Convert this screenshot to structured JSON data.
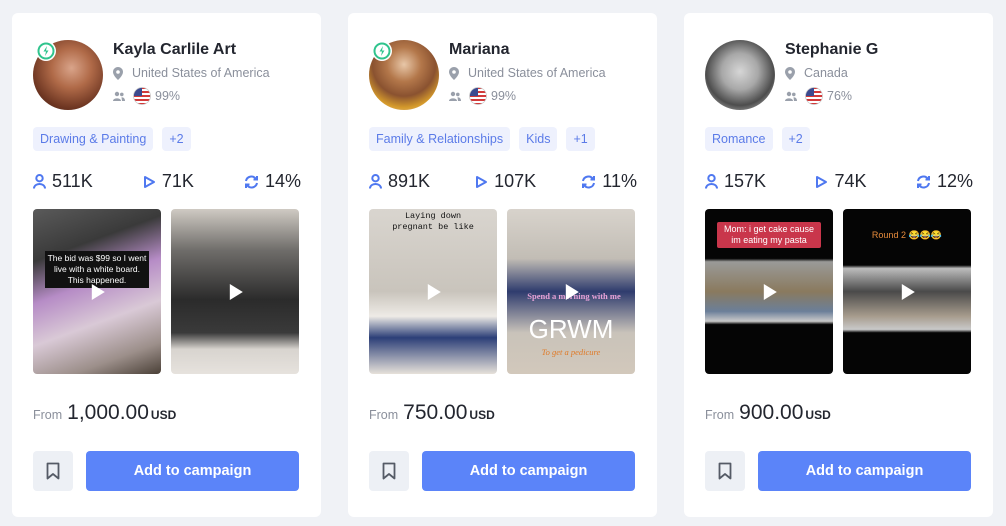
{
  "colors": {
    "accent": "#5b84f9",
    "tag_bg": "#eef1fd",
    "tag_text": "#5b7be8",
    "badge_green": "#2fc48d",
    "stat_icon": "#4f78f0",
    "page_bg": "#f0f2f6"
  },
  "cards": [
    {
      "name": "Kayla Carlile Art",
      "verified_badge": true,
      "location": "United States of America",
      "audience_country_flag": "us-flag",
      "audience_percent": "99%",
      "tags": [
        "Drawing & Painting",
        "+2"
      ],
      "stats": {
        "followers": "511K",
        "views": "71K",
        "engagement": "14%"
      },
      "videos": [
        {
          "caption": "The bid was $99 so I went live with a white board. This happened."
        },
        {
          "caption": ""
        }
      ],
      "price": {
        "from_label": "From",
        "amount": "1,000.00",
        "currency": "USD"
      },
      "add_label": "Add to campaign"
    },
    {
      "name": "Mariana",
      "verified_badge": true,
      "location": "United States of America",
      "audience_country_flag": "us-flag",
      "audience_percent": "99%",
      "tags": [
        "Family & Relationships",
        "Kids",
        "+1"
      ],
      "stats": {
        "followers": "891K",
        "views": "107K",
        "engagement": "11%"
      },
      "videos": [
        {
          "caption": "Laying down pregnant be like"
        },
        {
          "caption": "Spend a morning with me",
          "big_text": "GRWM",
          "sub_text": "To get a pedicure"
        }
      ],
      "price": {
        "from_label": "From",
        "amount": "750.00",
        "currency": "USD"
      },
      "add_label": "Add to campaign"
    },
    {
      "name": "Stephanie G",
      "verified_badge": false,
      "location": "Canada",
      "audience_country_flag": "us-flag",
      "audience_percent": "76%",
      "tags": [
        "Romance",
        "+2"
      ],
      "stats": {
        "followers": "157K",
        "views": "74K",
        "engagement": "12%"
      },
      "videos": [
        {
          "caption": "Mom: i get cake cause im eating my pasta"
        },
        {
          "caption": "Round 2 😂😂😂"
        }
      ],
      "price": {
        "from_label": "From",
        "amount": "900.00",
        "currency": "USD"
      },
      "add_label": "Add to campaign"
    }
  ]
}
